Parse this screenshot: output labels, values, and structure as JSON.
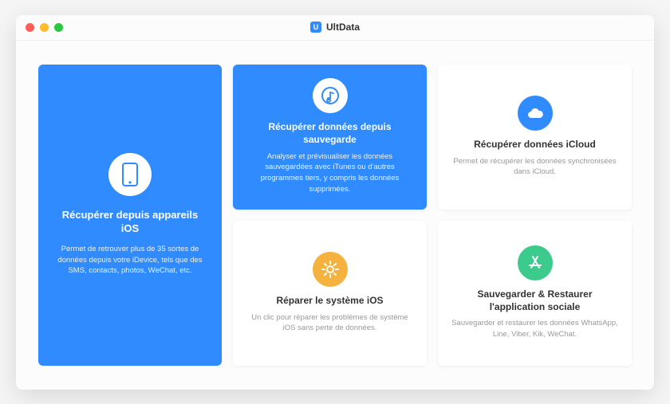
{
  "app": {
    "name": "UltData",
    "icon_letter": "U"
  },
  "cards": {
    "ios_device": {
      "title": "Récupérer depuis appareils iOS",
      "desc": "Permet de retrouver plus de 35 sortes de données depuis votre iDevice, tels que des SMS, contacts, photos, WeChat, etc."
    },
    "backup": {
      "title": "Récupérer données depuis sauvegarde",
      "desc": "Analyser et prévisualiser les données sauvegardées avec iTunes ou d'autres programmes tiers, y compris les données supprimées."
    },
    "icloud": {
      "title": "Récupérer données iCloud",
      "desc": "Permet de récupérer les données synchronisées dans iCloud."
    },
    "repair": {
      "title": "Réparer le système iOS",
      "desc": "Un clic pour réparer les problèmes de système iOS sans perte de données."
    },
    "social": {
      "title": "Sauvegarder & Restaurer l'application sociale",
      "desc": "Sauvegarder et restaurer les données WhatsApp, Line, Viber, Kik, WeChat."
    }
  },
  "colors": {
    "primary": "#2f8bff",
    "icloud_icon": "#2f8bff",
    "repair_icon": "#f6b23e",
    "social_icon": "#3dcb8d"
  }
}
